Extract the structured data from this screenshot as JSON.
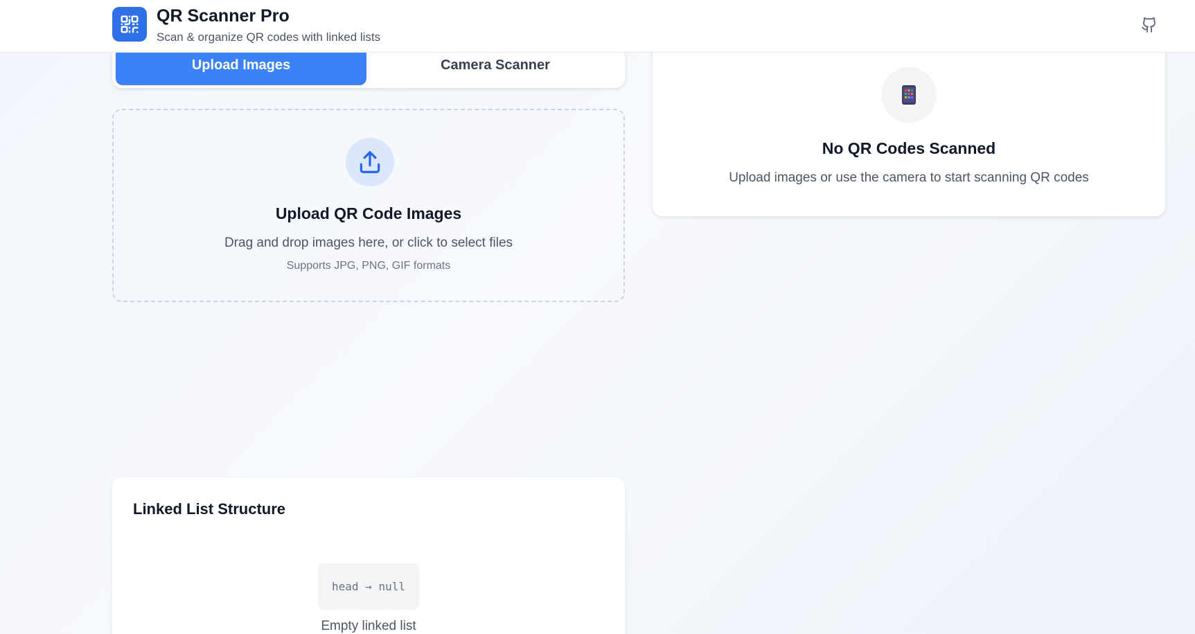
{
  "header": {
    "title": "QR Scanner Pro",
    "subtitle": "Scan & organize QR codes with linked lists",
    "logo_icon": "qr-code-icon",
    "github_icon": "github-icon",
    "accent_color": "#2f6fe8"
  },
  "tabs": [
    {
      "label": "Upload Images",
      "active": true
    },
    {
      "label": "Camera Scanner",
      "active": false
    }
  ],
  "upload": {
    "icon": "upload-icon",
    "title": "Upload QR Code Images",
    "description": "Drag and drop images here, or click to select files",
    "formats": "Supports JPG, PNG, GIF formats"
  },
  "results": {
    "icon": "mobile-phone-icon",
    "title": "No QR Codes Scanned",
    "description": "Upload images or use the camera to start scanning QR codes"
  },
  "linked_list": {
    "title": "Linked List Structure",
    "node_text": "head → null",
    "empty_text": "Empty linked list"
  }
}
